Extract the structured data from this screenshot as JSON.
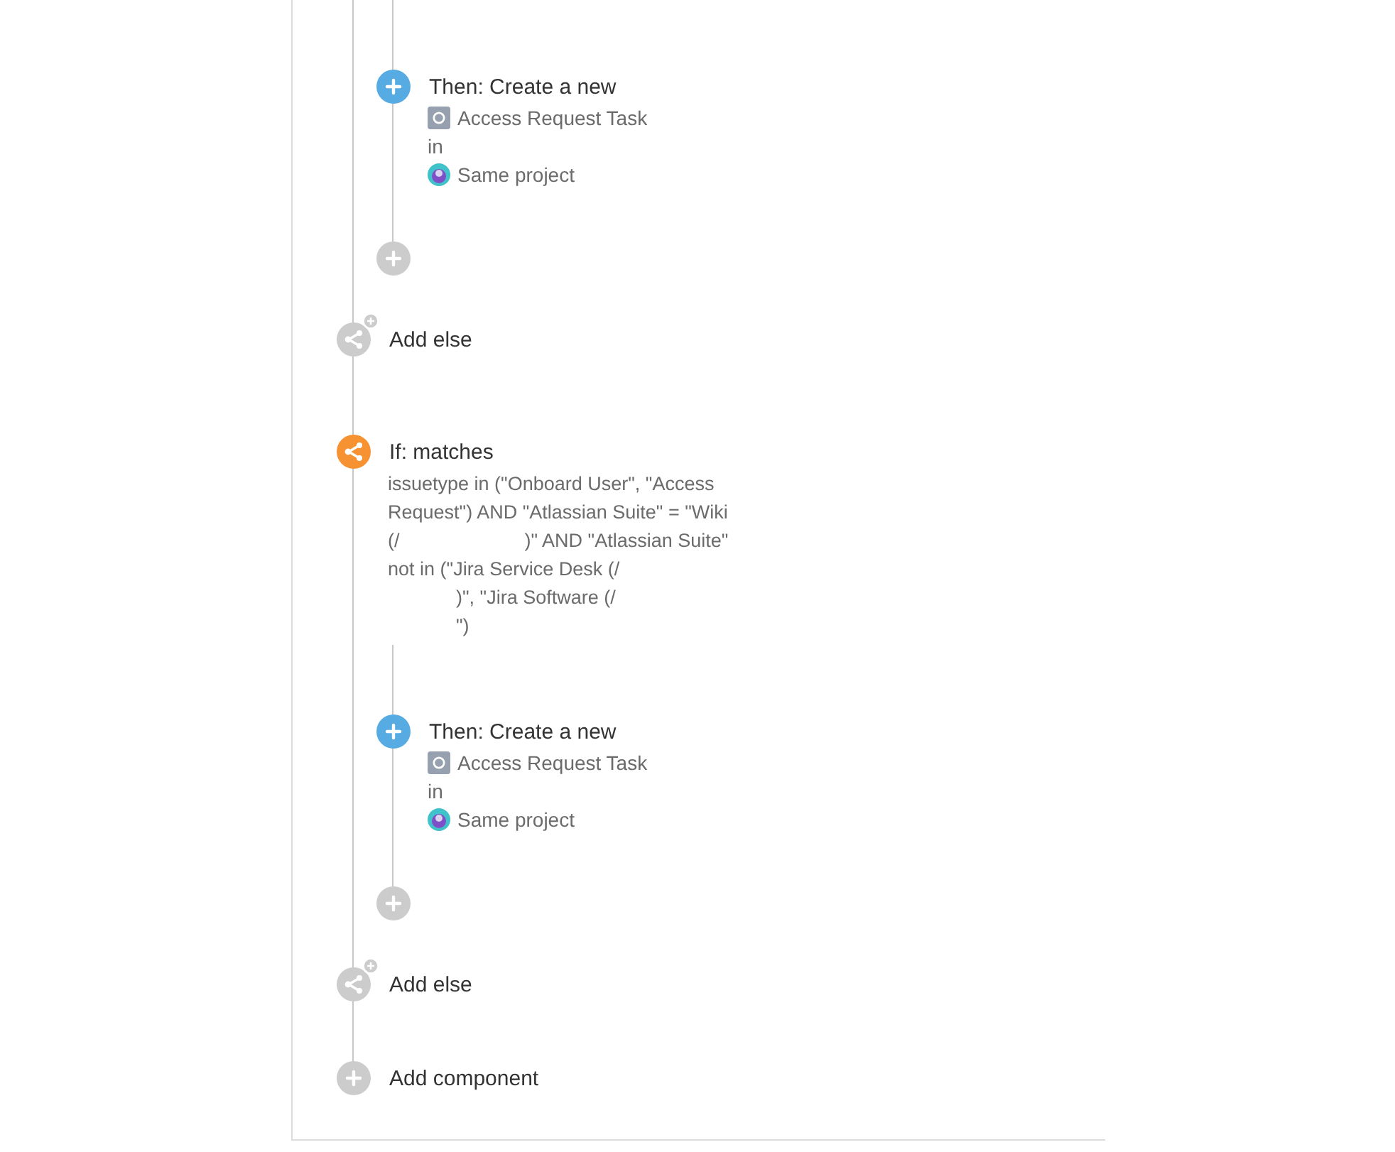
{
  "steps": [
    {
      "kind": "group",
      "items": [
        {
          "kind": "action",
          "title": "Then: Create a new",
          "issue_type": "Access Request Task",
          "connector": "in",
          "project": "Same project"
        },
        {
          "kind": "add"
        }
      ]
    },
    {
      "kind": "add_else",
      "label": "Add else"
    },
    {
      "kind": "condition",
      "title": "If: matches",
      "lines": [
        [
          {
            "kind": "text",
            "text": "issuetype in (\"Onboard User\", \"Access"
          }
        ],
        [
          {
            "kind": "text",
            "text": "Request\") AND \"Atlassian Suite\" = \"Wiki"
          }
        ],
        [
          {
            "kind": "text",
            "text": "(/"
          },
          {
            "kind": "blank",
            "wide": true
          },
          {
            "kind": "text",
            "text": ")\" AND \"Atlassian Suite\""
          }
        ],
        [
          {
            "kind": "text",
            "text": "not in (\"Jira Service Desk (/"
          }
        ],
        [
          {
            "kind": "blank",
            "wide": false
          },
          {
            "kind": "text",
            "text": ")\", \"Jira Software (/"
          }
        ],
        [
          {
            "kind": "blank",
            "wide": false
          },
          {
            "kind": "text",
            "text": "\")"
          }
        ]
      ]
    },
    {
      "kind": "group",
      "items": [
        {
          "kind": "action",
          "title": "Then: Create a new",
          "issue_type": "Access Request Task",
          "connector": "in",
          "project": "Same project"
        },
        {
          "kind": "add"
        }
      ]
    },
    {
      "kind": "add_else",
      "label": "Add else"
    },
    {
      "kind": "add_component",
      "label": "Add component"
    }
  ]
}
